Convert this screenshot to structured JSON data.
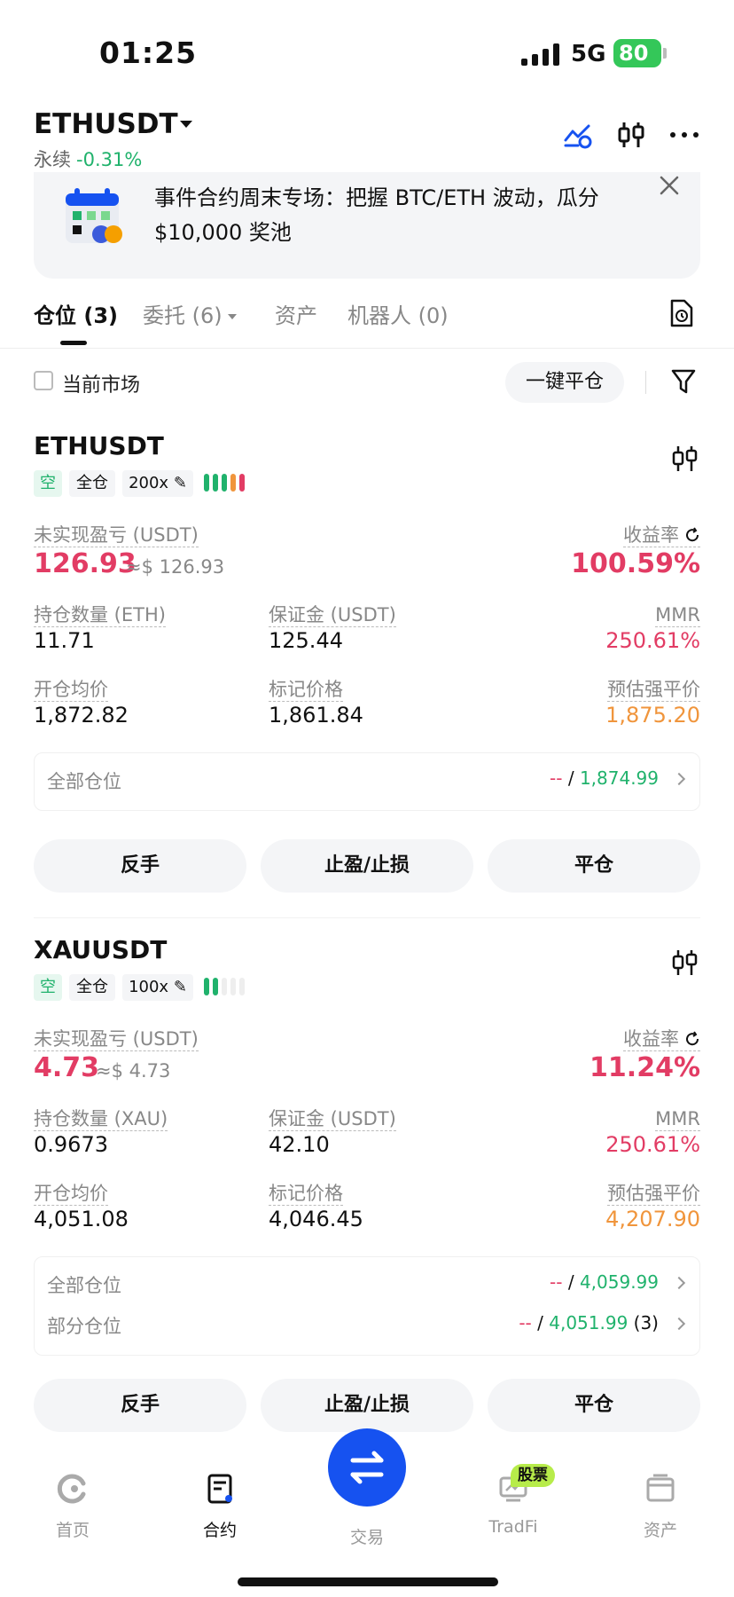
{
  "status_bar": {
    "time": "01:25",
    "network": "5G",
    "battery": "80"
  },
  "header": {
    "symbol": "ETHUSDT",
    "type": "永续",
    "change": "-0.31%"
  },
  "banner": {
    "text": "事件合约周末专场：把握 BTC/ETH 波动，瓜分 $10,000 奖池"
  },
  "tabs": [
    {
      "label": "仓位 (3)"
    },
    {
      "label": "委托 (6)"
    },
    {
      "label": "资产"
    },
    {
      "label": "机器人 (0)"
    }
  ],
  "filter": {
    "current_market": "当前市场",
    "close_all": "一键平仓"
  },
  "positions": [
    {
      "symbol": "ETHUSDT",
      "side": "空",
      "margin_mode": "全仓",
      "leverage": "200x",
      "adl_level": 5,
      "pnl_label": "未实现盈亏 (USDT)",
      "pnl": "126.93",
      "pnl_usd": "≈$ 126.93",
      "roe_label": "收益率",
      "roe": "100.59%",
      "size_label": "持仓数量 (ETH)",
      "size": "11.71",
      "margin_label": "保证金 (USDT)",
      "margin": "125.44",
      "mmr_label": "MMR",
      "mmr": "250.61%",
      "entry_label": "开仓均价",
      "entry": "1,872.82",
      "mark_label": "标记价格",
      "mark": "1,861.84",
      "liq_label": "预估强平价",
      "liq": "1,875.20",
      "tpsl_rows": [
        {
          "label": "全部仓位",
          "tp": "--",
          "sl": "1,874.99",
          "count": ""
        }
      ]
    },
    {
      "symbol": "XAUUSDT",
      "side": "空",
      "margin_mode": "全仓",
      "leverage": "100x",
      "adl_level": 2,
      "pnl_label": "未实现盈亏 (USDT)",
      "pnl": "4.73",
      "pnl_usd": "≈$ 4.73",
      "roe_label": "收益率",
      "roe": "11.24%",
      "size_label": "持仓数量 (XAU)",
      "size": "0.9673",
      "margin_label": "保证金 (USDT)",
      "margin": "42.10",
      "mmr_label": "MMR",
      "mmr": "250.61%",
      "entry_label": "开仓均价",
      "entry": "4,051.08",
      "mark_label": "标记价格",
      "mark": "4,046.45",
      "liq_label": "预估强平价",
      "liq": "4,207.90",
      "tpsl_rows": [
        {
          "label": "全部仓位",
          "tp": "--",
          "sl": "4,059.99",
          "count": ""
        },
        {
          "label": "部分仓位",
          "tp": "--",
          "sl": "4,051.99",
          "count": "(3)"
        }
      ]
    }
  ],
  "actions": {
    "reverse": "反手",
    "tpsl": "止盈/止损",
    "close": "平仓"
  },
  "bottom_nav": [
    {
      "label": "首页",
      "icon": "home-icon"
    },
    {
      "label": "合约",
      "icon": "futures-icon"
    },
    {
      "label": "交易",
      "icon": "swap-icon"
    },
    {
      "label": "TradFi",
      "icon": "tradfi-icon",
      "badge": "股票"
    },
    {
      "label": "资产",
      "icon": "wallet-icon"
    }
  ],
  "colors": {
    "green": "#20b26c",
    "red": "#e23c64",
    "orange": "#f0953c",
    "blue": "#1652f0",
    "badge": "#b7ec4a"
  }
}
